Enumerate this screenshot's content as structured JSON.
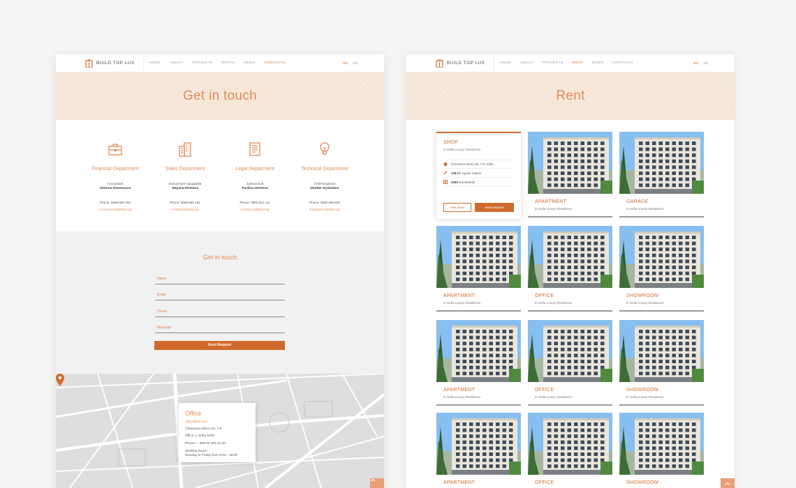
{
  "brand": {
    "name": "BUILD TOP LUX"
  },
  "left": {
    "nav": {
      "items": [
        "HOME",
        "ABOUT",
        "PROJECTS",
        "RENTS",
        "NEWS",
        "CONTACTS"
      ],
      "active": 5
    },
    "langs": [
      "BG",
      "EN"
    ],
    "hero_title": "Get in touch",
    "departments": [
      {
        "name": "Financial Department",
        "role": "Accountant",
        "person": "Simona Simeonova",
        "phone": "Phone: 0888 669 164",
        "email": "s.simeonova@btlux.bg",
        "icon": "briefcase-icon"
      },
      {
        "name": "Sales Department",
        "role": "Консултант продажби",
        "person": "Tatyana Hristova",
        "phone": "Phone: 0888 669 181",
        "email": "t.hristova@btlux.bg",
        "icon": "building-icon"
      },
      {
        "name": "Legal Department",
        "role": "Jurisconsult",
        "person": "Pavlina Hristova",
        "phone": "Phone: 0882 941 111",
        "email": "p.hristova@btlux.bg",
        "icon": "book-icon"
      },
      {
        "name": "Technical Department",
        "role": "Chief Engineer",
        "person": "Dimiter Kyulumov",
        "phone": "Phone: 0888 669 502",
        "email": "d.kyulumov@btlux.bg",
        "icon": "lightbulb-icon"
      }
    ],
    "form": {
      "title": "Get in touch",
      "fields": {
        "name": "Name",
        "email": "Email",
        "phone": "Phone",
        "message": "Message"
      },
      "submit": "Send Request"
    },
    "office": {
      "title": "Office",
      "email": "office@btl.com",
      "address": "Cherwena Stena Str. 7-9",
      "address2": "Office 1, Sofia 1000",
      "phone": "Phone: + 359 02 405 14 60",
      "hours_label": "Working hours:",
      "hours": "Monday to Friday from 9:00 - 18:00"
    }
  },
  "right": {
    "nav": {
      "items": [
        "HOME",
        "ABOUT",
        "PROJECTS",
        "RENT",
        "NEWS",
        "CONTACTS"
      ],
      "active": 3
    },
    "langs": [
      "BG",
      "EN"
    ],
    "hero_title": "Rent",
    "shop": {
      "title": "SHOP",
      "subtitle": "in Sofia Luxury Residence",
      "address": "Cherwena Stena Str. 7-9, Sofia",
      "area_value": "135.71",
      "area_unit": "square meters",
      "price_value": "2000",
      "price_unit": "Euro/Month",
      "see_more": "See more",
      "send_request": "Send request"
    },
    "listings": [
      {
        "type": "APARTMENT",
        "subtitle": "in Sofia Luxury Residence"
      },
      {
        "type": "GARAGE",
        "subtitle": "in Sofia Luxury Residence"
      },
      {
        "type": "APARTMENT",
        "subtitle": "in Sofia Luxury Residence"
      },
      {
        "type": "OFFICE",
        "subtitle": "in Sofia Luxury Residence"
      },
      {
        "type": "SHOWROOM",
        "subtitle": "in Sofia Luxury Residence"
      },
      {
        "type": "APARTMENT",
        "subtitle": "in Sofia Luxury Residence"
      },
      {
        "type": "OFFICE",
        "subtitle": "in Sofia Luxury Residence"
      },
      {
        "type": "SHOWROOM",
        "subtitle": "in Sofia Luxury Residence"
      },
      {
        "type": "APARTMENT",
        "subtitle": ""
      },
      {
        "type": "OFFICE",
        "subtitle": ""
      },
      {
        "type": "SHOWROOM",
        "subtitle": ""
      }
    ]
  },
  "colors": {
    "accent": "#d06a2c",
    "accent_light": "#e08a55",
    "hero_bg": "#f6e6d8"
  }
}
